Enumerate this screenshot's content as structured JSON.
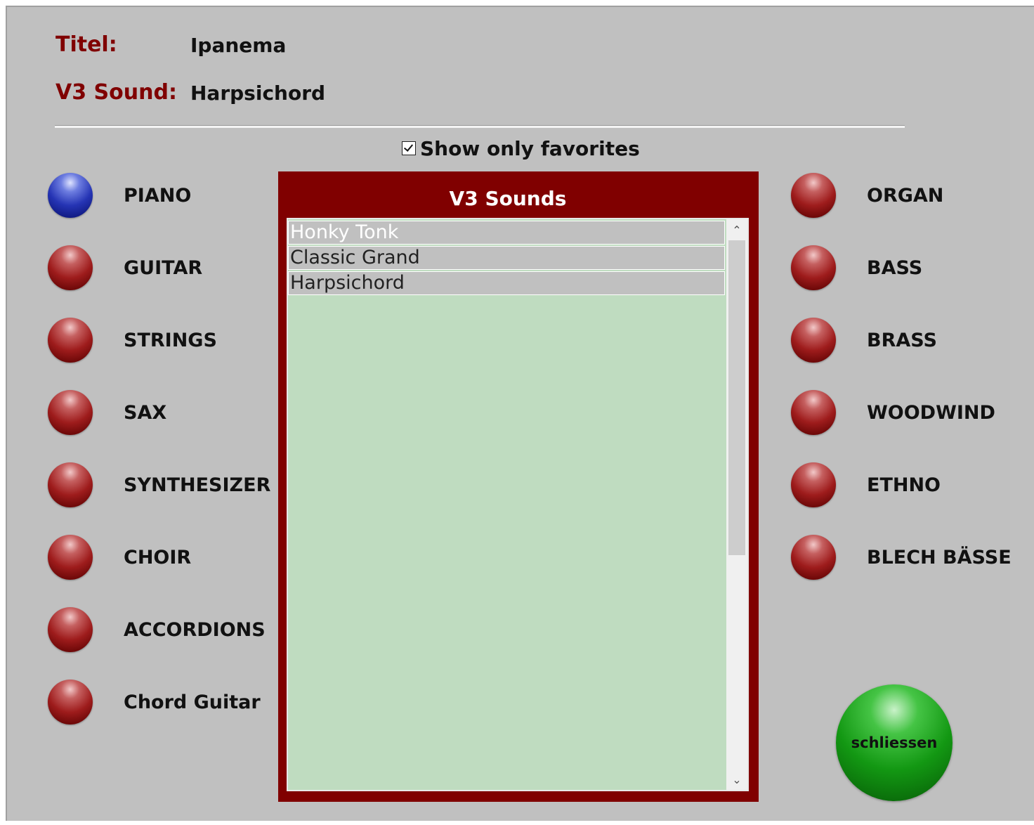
{
  "header": {
    "title_label": "Titel:",
    "title_value": "Ipanema",
    "sound_label": "V3 Sound:",
    "sound_value": "Harpsichord"
  },
  "favorites": {
    "checked": true,
    "label": "Show only favorites"
  },
  "categories_left": [
    {
      "label": "PIANO",
      "active": true
    },
    {
      "label": "GUITAR",
      "active": false
    },
    {
      "label": "STRINGS",
      "active": false
    },
    {
      "label": "SAX",
      "active": false
    },
    {
      "label": "SYNTHESIZER",
      "active": false
    },
    {
      "label": "CHOIR",
      "active": false
    },
    {
      "label": "ACCORDIONS",
      "active": false
    },
    {
      "label": "Chord Guitar",
      "active": false
    }
  ],
  "categories_right": [
    {
      "label": "ORGAN",
      "active": false
    },
    {
      "label": "BASS",
      "active": false
    },
    {
      "label": "BRASS",
      "active": false
    },
    {
      "label": "WOODWIND",
      "active": false
    },
    {
      "label": "ETHNO",
      "active": false
    },
    {
      "label": "BLECH BÄSSE",
      "active": false
    }
  ],
  "sound_panel": {
    "title": "V3 Sounds",
    "items": [
      "Honky Tonk",
      "Classic Grand",
      "Harpsichord"
    ]
  },
  "close_button": {
    "label": "schliessen"
  },
  "colors": {
    "background": "#c0c0c0",
    "label_accent": "#800000",
    "panel": "#800000",
    "list_background": "#bfdcc0",
    "active_button": "#2534b4",
    "inactive_button": "#9e1c1c",
    "close_button": "#139813"
  }
}
